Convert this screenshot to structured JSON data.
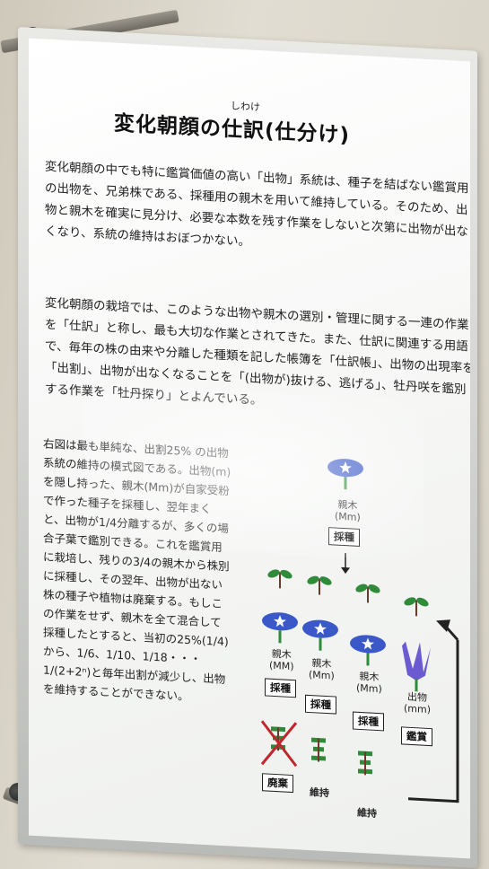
{
  "poster": {
    "ruby": "しわけ",
    "title": "変化朝顔の仕訳(仕分け)",
    "para1": "変化朝顔の中でも特に鑑賞価値の高い「出物」系統は、種子を結ばない鑑賞用の出物を、兄弟株である、採種用の親木を用いて維持している。そのため、出物と親木を確実に見分け、必要な本数を残す作業をしないと次第に出物が出なくなり、系統の維持はおぼつかない。",
    "para2": "変化朝顔の栽培では、このような出物や親木の選別・管理に関する一連の作業を「仕訳」と称し、最も大切な作業とされてきた。また、仕訳に関連する用語で、毎年の株の由来や分離した種類を記した帳簿を「仕訳帳」、出物の出現率を「出割」、出物が出なくなることを「(出物が)抜ける、逃げる」、牡丹咲を鑑別する作業を「牡丹探り」とよんでいる。",
    "left_text": "右図は最も単純な、出割25% の出物系統の維持の模式図である。出物(m)を隠し持った、親木(Mm)が自家受粉で作った種子を採種し、翌年まくと、出物が1/4分離するが、多くの場合子葉で鑑別できる。これを鑑賞用に栽培し、残りの3/4の親木から株別に採種し、その翌年、出物が出ない株の種子や植物は廃棄する。もしこの作業をせず、親木を全て混合して採種したとすると、当初の25%(1/4)から、1/6、1/10、1/18・・・1/(2+2ⁿ)と毎年出割が減少し、出物を維持することができない。"
  },
  "diagram": {
    "parent_label": "親木",
    "parent_genotype": "(Mm)",
    "harvest_label": "採種",
    "plants": [
      {
        "name": "親木",
        "genotype": "(MM)",
        "action": "採種",
        "result": "廃棄"
      },
      {
        "name": "親木",
        "genotype": "(Mm)",
        "action": "採種",
        "result": "維持"
      },
      {
        "name": "親木",
        "genotype": "(Mm)",
        "action": "採種",
        "result": "維持"
      },
      {
        "name": "出物",
        "genotype": "(mm)",
        "action": "鑑賞",
        "result": ""
      }
    ]
  },
  "colors": {
    "accent_red": "#c0262e",
    "flower_blue": "#3a58c8",
    "leaf_green": "#2f8a3a"
  }
}
